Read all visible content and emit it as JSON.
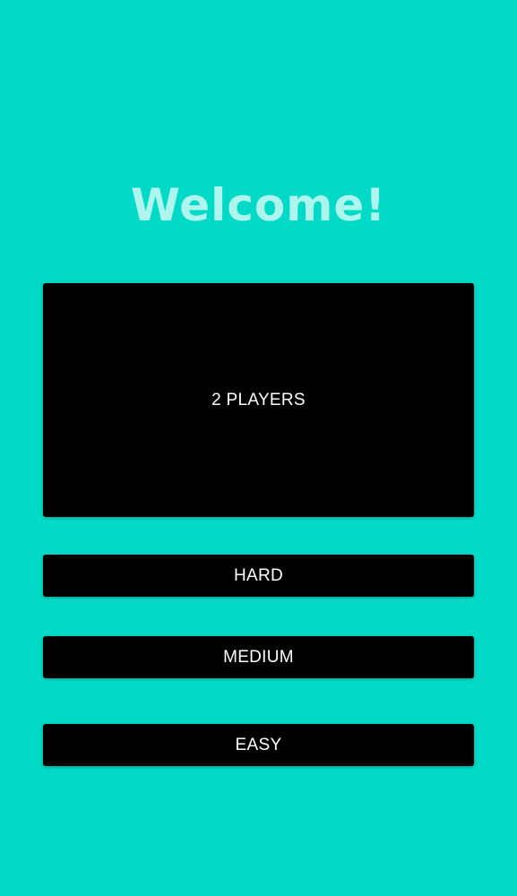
{
  "screen": {
    "title": "Welcome!",
    "background_color": "#02d9c6",
    "title_color": "#aef5ee",
    "button_color": "#000000",
    "button_text_color": "#ffffff"
  },
  "menu": {
    "two_players_label": "2 PLAYERS",
    "hard_label": "HARD",
    "medium_label": "MEDIUM",
    "easy_label": "EASY"
  }
}
